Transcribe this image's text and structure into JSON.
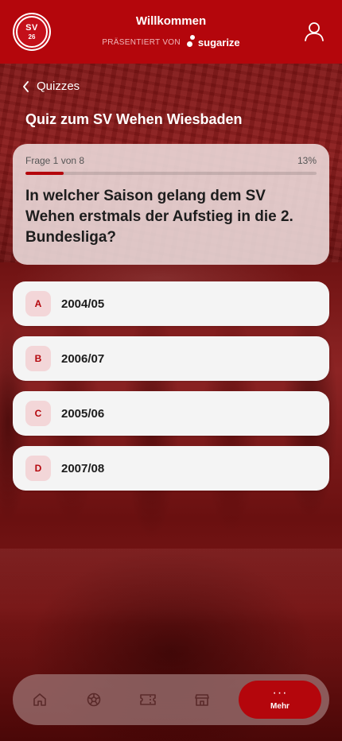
{
  "header": {
    "logo": {
      "line1": "SV",
      "line2": "26"
    },
    "title": "Willkommen",
    "presented_by": "PRÄSENTIERT VON",
    "sponsor": "sugarize",
    "profile_icon": "user-icon"
  },
  "nav_back": {
    "label": "Quizzes",
    "icon": "chevron-left-icon"
  },
  "page_title": "Quiz zum SV Wehen Wiesbaden",
  "question": {
    "counter": "Frage 1 von 8",
    "percent_label": "13%",
    "progress": 0.13,
    "text": "In welcher Saison gelang dem SV Wehen erstmals der Aufstieg in die 2. Bundesliga?"
  },
  "answers": [
    {
      "letter": "A",
      "text": "2004/05"
    },
    {
      "letter": "B",
      "text": "2006/07"
    },
    {
      "letter": "C",
      "text": "2005/06"
    },
    {
      "letter": "D",
      "text": "2007/08"
    }
  ],
  "bottom_nav": {
    "items": [
      {
        "icon": "home-icon"
      },
      {
        "icon": "football-icon"
      },
      {
        "icon": "ticket-icon"
      },
      {
        "icon": "store-icon"
      }
    ],
    "more": {
      "label": "Mehr",
      "dots": "···"
    }
  },
  "colors": {
    "brand_red": "#b4060c",
    "letter_badge_bg": "#f3d6d8",
    "card_bg": "#f4f4f4"
  }
}
